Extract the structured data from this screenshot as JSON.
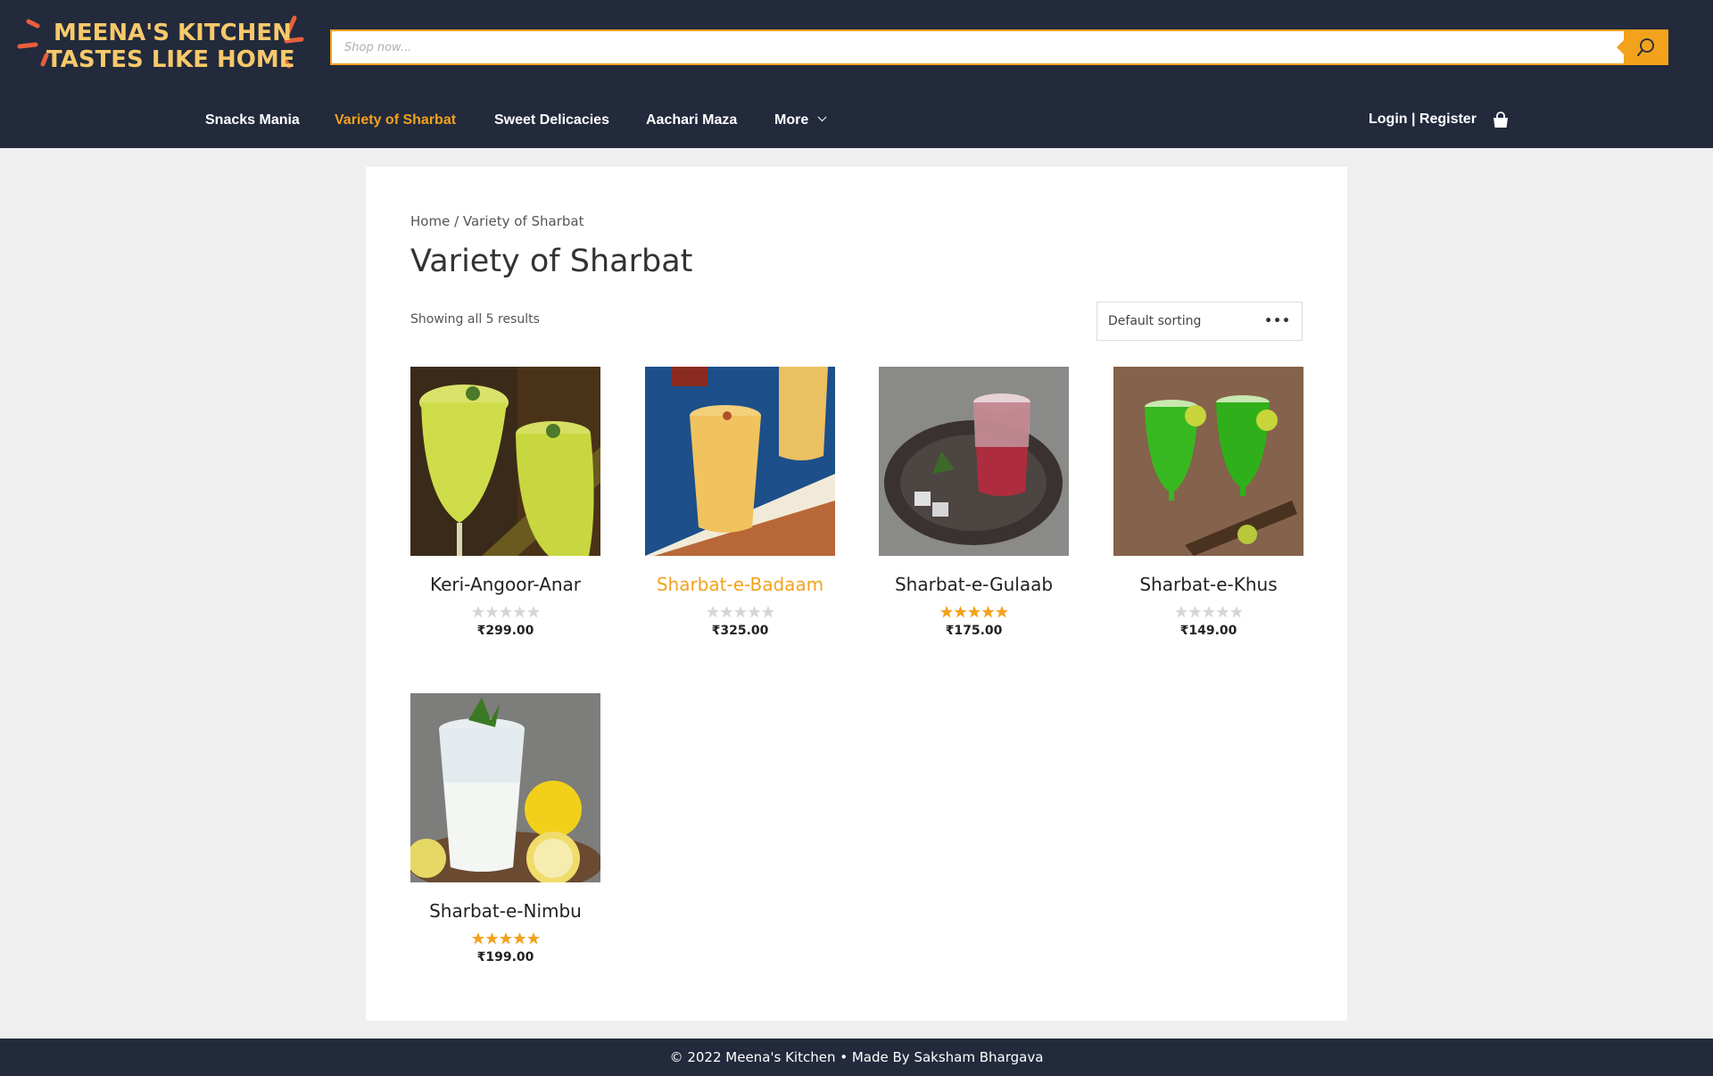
{
  "brand": {
    "line1": "MEENA'S KITCHEN",
    "line2": "TASTES LIKE HOME"
  },
  "search": {
    "placeholder": "Shop now..."
  },
  "nav": {
    "items": [
      "Snacks Mania",
      "Variety of Sharbat",
      "Sweet Delicacies",
      "Aachari Maza",
      "More"
    ],
    "active": "Variety of Sharbat",
    "login": "Login | Register"
  },
  "colors": {
    "header_bg": "#222a3c",
    "accent": "#f2a21d",
    "page_bg": "#efefef"
  },
  "breadcrumb": "Home / Variety of Sharbat",
  "title": "Variety of Sharbat",
  "result_count": "Showing all 5 results",
  "sorting": {
    "selected": "Default sorting"
  },
  "products": [
    {
      "name": "Keri-Angoor-Anar",
      "price": "₹299.00",
      "rating": 0,
      "image": "lime-juice-glasses"
    },
    {
      "name": "Sharbat-e-Badaam",
      "price": "₹325.00",
      "rating": 0,
      "image": "almond-milk-glass"
    },
    {
      "name": "Sharbat-e-Gulaab",
      "price": "₹175.00",
      "rating": 5,
      "image": "rose-drink-glass"
    },
    {
      "name": "Sharbat-e-Khus",
      "price": "₹149.00",
      "rating": 0,
      "image": "green-khus-glasses"
    },
    {
      "name": "Sharbat-e-Nimbu",
      "price": "₹199.00",
      "rating": 5,
      "image": "lemonade-glass"
    }
  ],
  "footer": "© 2022 Meena's Kitchen • Made By Saksham Bhargava"
}
